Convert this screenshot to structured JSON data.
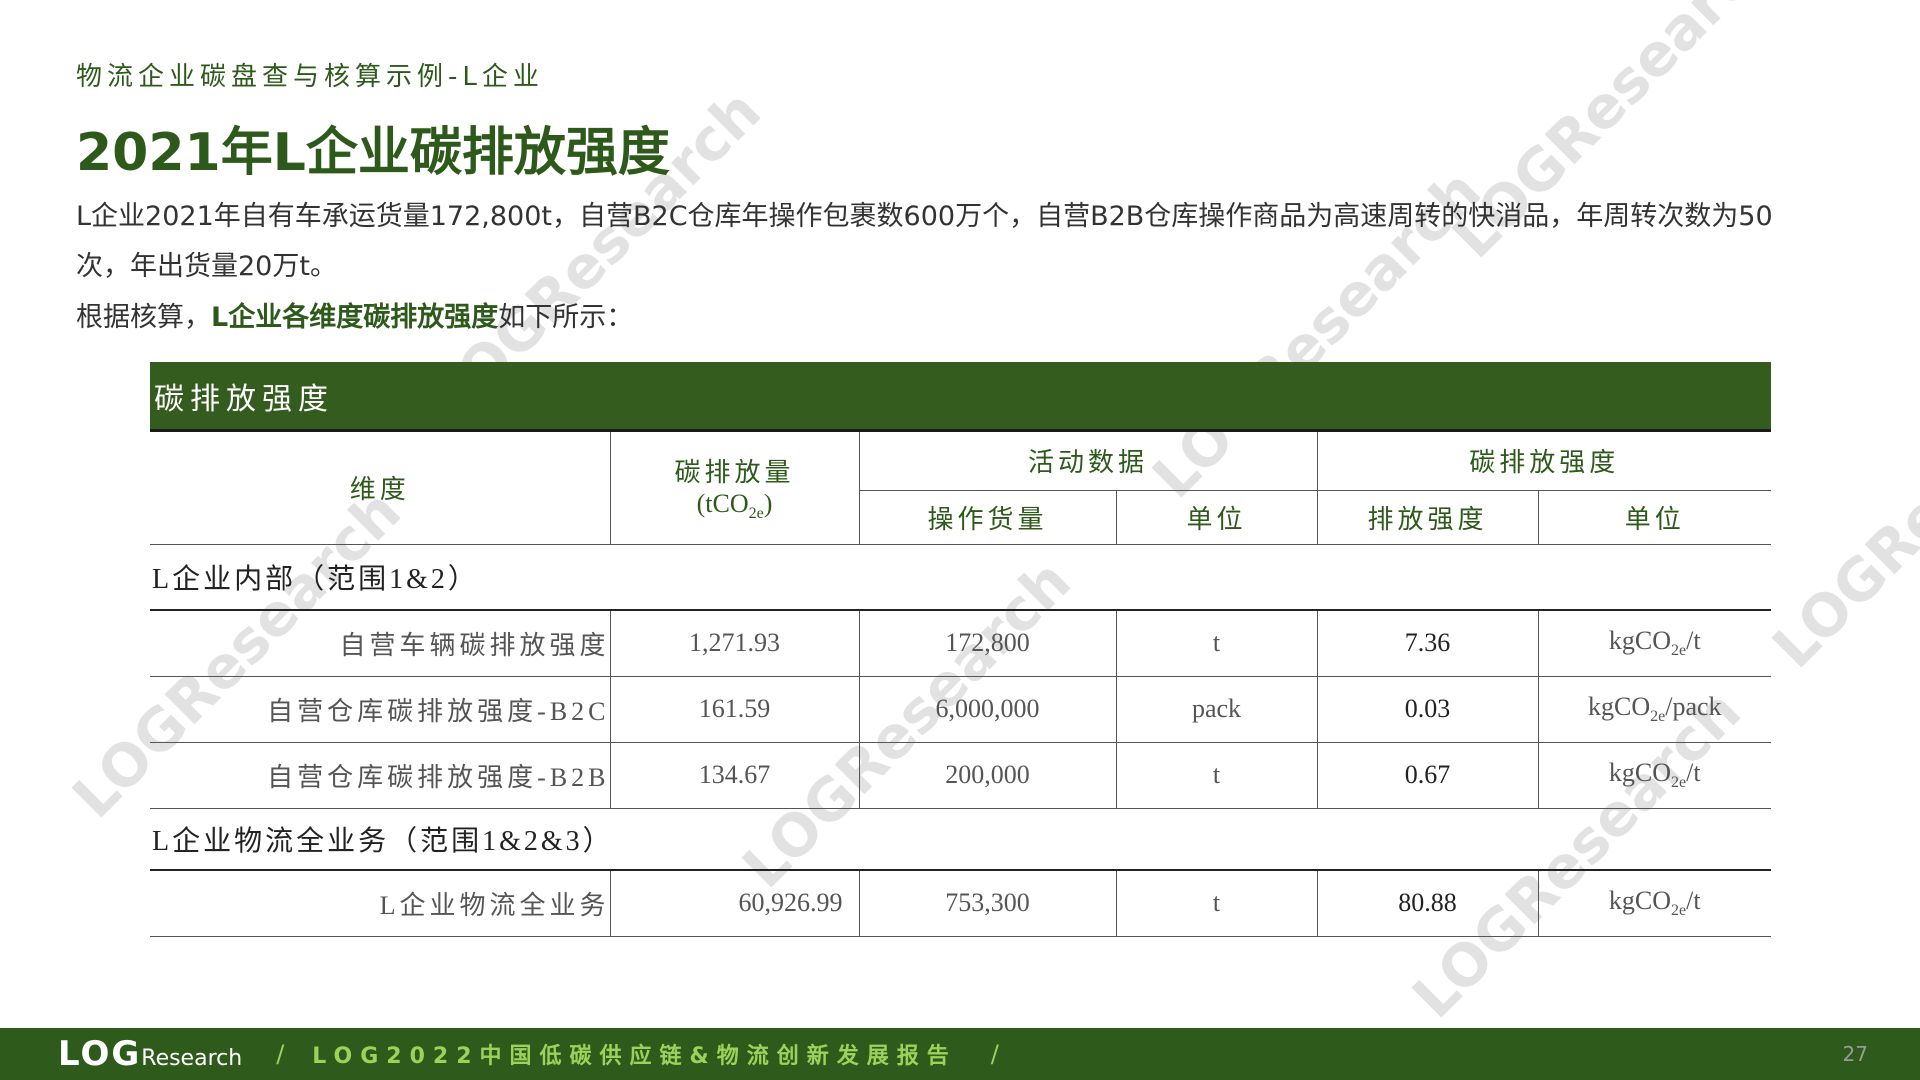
{
  "subtitle": "物流企业碳盘查与核算示例-L企业",
  "title": "2021年L企业碳排放强度",
  "para1": "L企业2021年自有车承运货量172,800t，自营B2C仓库年操作包裹数600万个，自营B2B仓库操作商品为高速周转的快消品，年周转次数为50次，年出货量20万t。",
  "para2": {
    "prefix": "根据核算，",
    "bold": "L企业各维度碳排放强度",
    "suffix": "如下所示："
  },
  "table": {
    "header": "碳排放强度",
    "col_dimension": "维度",
    "col_emission": "碳排放量",
    "col_emission_unit_a": "(tCO",
    "col_emission_unit_sub": "2e",
    "col_emission_unit_b": ")",
    "group_activity": "活动数据",
    "group_intensity": "碳排放强度",
    "col_volume": "操作货量",
    "col_unit": "单位",
    "col_intensity": "排放强度",
    "col_intensity_unit": "单位",
    "section1": "L企业内部（范围1&2）",
    "rows1": [
      {
        "dim": "自营车辆碳排放强度",
        "emission": "1,271.93",
        "volume": "172,800",
        "unit": "t",
        "intensity": "7.36",
        "iu_a": "kgCO",
        "iu_sub": "2e",
        "iu_b": "/t"
      },
      {
        "dim": "自营仓库碳排放强度-B2C",
        "emission": "161.59",
        "volume": "6,000,000",
        "unit": "pack",
        "intensity": "0.03",
        "iu_a": "kgCO",
        "iu_sub": "2e",
        "iu_b": "/pack"
      },
      {
        "dim": "自营仓库碳排放强度-B2B",
        "emission": "134.67",
        "volume": "200,000",
        "unit": "t",
        "intensity": "0.67",
        "iu_a": "kgCO",
        "iu_sub": "2e",
        "iu_b": "/t"
      }
    ],
    "section2": "L企业物流全业务（范围1&2&3）",
    "rows2": [
      {
        "dim": "L企业物流全业务",
        "emission": "60,926.99",
        "volume": "753,300",
        "unit": "t",
        "intensity": "80.88",
        "iu_a": "kgCO",
        "iu_sub": "2e",
        "iu_b": "/t"
      }
    ]
  },
  "watermark": "LOGResearch",
  "footer": {
    "logo": "LOG",
    "logo_small": "Research",
    "slash": "/",
    "report": "LOG2022中国低碳供应链&物流创新发展报告",
    "page": "27"
  },
  "colors": {
    "brand_green": "#335c1e",
    "footer_green": "#2e5a1c",
    "accent_lime": "#9bd35a"
  }
}
